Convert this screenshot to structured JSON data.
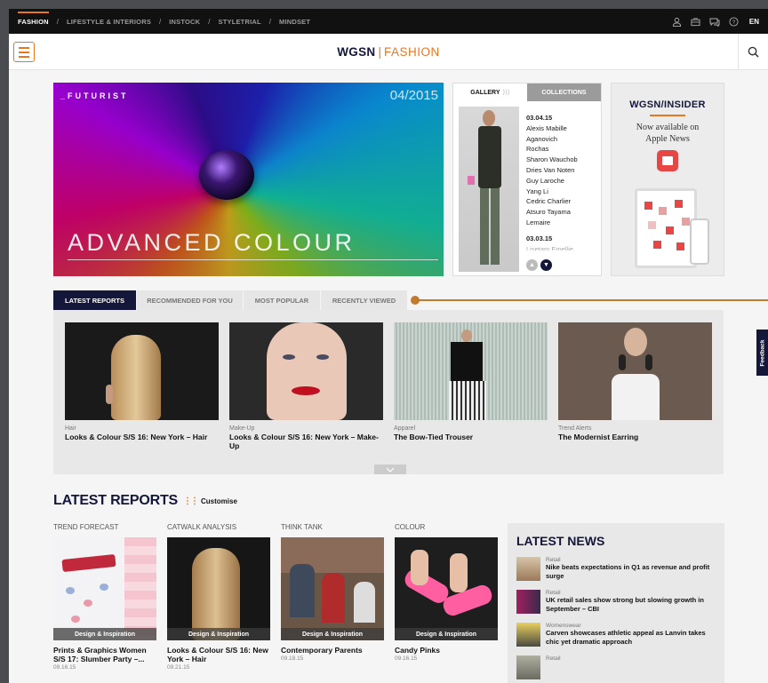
{
  "topnav": {
    "items": [
      {
        "label": "FASHION",
        "active": true
      },
      {
        "label": "LIFESTYLE & INTERIORS"
      },
      {
        "label": "INSTOCK"
      },
      {
        "label": "STYLETRIAL"
      },
      {
        "label": "MINDSET"
      }
    ],
    "separator": "/",
    "lang": "EN"
  },
  "header": {
    "logo_mark": "WGSN",
    "logo_divider": "|",
    "logo_section": "FASHION"
  },
  "hero": {
    "kicker": "_FUTURIST",
    "date": "04/2015",
    "title": "ADVANCED COLOUR"
  },
  "gallery": {
    "tab_gallery": "GALLERY",
    "tab_collections": "COLLECTIONS",
    "date1": "03.04.15",
    "designers": [
      "Alexis Mabille",
      "Aganovich",
      "Rochas",
      "Sharon Wauchob",
      "Dries Van Noten",
      "Guy Laroche",
      "Yang Li",
      "Cedric Charlier",
      "Atsuro Tayama",
      "Lemaire"
    ],
    "date2": "03.03.15",
    "faded": "Lisetam Emellie"
  },
  "insider": {
    "brand": "WGSN/INSIDER",
    "line1": "Now available on",
    "line2": "Apple News"
  },
  "report_tabs": [
    "LATEST REPORTS",
    "RECOMMENDED FOR YOU",
    "MOST POPULAR",
    "RECENTLY VIEWED"
  ],
  "carousel": [
    {
      "category": "Hair",
      "title": "Looks & Colour S/S 16: New York – Hair"
    },
    {
      "category": "Make-Up",
      "title": "Looks & Colour S/S 16: New York – Make-Up"
    },
    {
      "category": "Apparel",
      "title": "The Bow-Tied Trouser"
    },
    {
      "category": "Trend Alerts",
      "title": "The Modernist Earring"
    }
  ],
  "latest": {
    "title": "LATEST REPORTS",
    "customise": "Customise",
    "columns": [
      {
        "head": "TREND FORECAST",
        "overlay": "Design & Inspiration",
        "title": "Prints & Graphics Women S/S 17: Slumber Party –...",
        "date": "09.16.15"
      },
      {
        "head": "CATWALK ANALYSIS",
        "overlay": "Design & Inspiration",
        "title": "Looks & Colour S/S 16: New York – Hair",
        "date": "09.21.15"
      },
      {
        "head": "THINK TANK",
        "overlay": "Design & Inspiration",
        "title": "Contemporary Parents",
        "date": "09.18.15"
      },
      {
        "head": "COLOUR",
        "overlay": "Design & Inspiration",
        "title": "Candy Pinks",
        "date": "09.16.15"
      }
    ]
  },
  "news": {
    "title": "LATEST NEWS",
    "items": [
      {
        "cat": "Retail",
        "title": "Nike beats expectations in Q1 as revenue and profit surge"
      },
      {
        "cat": "Retail",
        "title": "UK retail sales show strong but slowing growth in September – CBI"
      },
      {
        "cat": "Womenswear",
        "title": "Carven showcases athletic appeal as Lanvin takes chic yet dramatic approach"
      },
      {
        "cat": "Retail",
        "title": ""
      }
    ]
  },
  "feedback": "Feedback"
}
